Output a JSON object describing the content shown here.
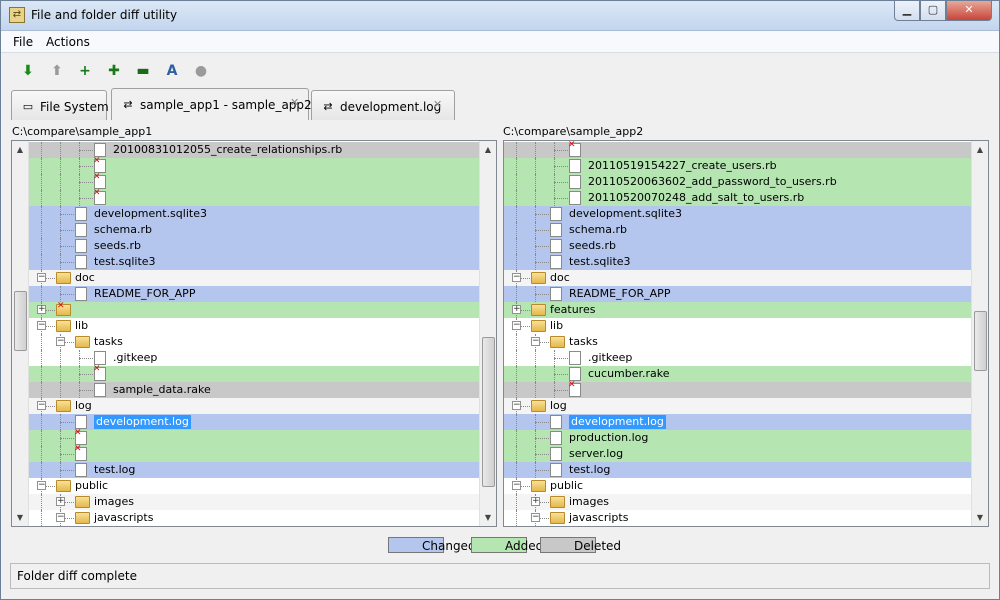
{
  "window": {
    "title": "File and folder diff utility",
    "minimize": "▁",
    "maximize": "▢",
    "close": "✕"
  },
  "menu": [
    "File",
    "Actions"
  ],
  "toolbar": [
    {
      "name": "next-diff-icon",
      "glyph": "⬇",
      "color": "#1a8a1a"
    },
    {
      "name": "prev-diff-icon",
      "glyph": "⬆",
      "color": "#9a9a9a"
    },
    {
      "name": "expand-added-icon",
      "glyph": "+",
      "color": "#1a7a1a"
    },
    {
      "name": "expand-all-icon",
      "glyph": "✚",
      "color": "#1a7a1a"
    },
    {
      "name": "collapse-all-icon",
      "glyph": "▬",
      "color": "#1a6a1a"
    },
    {
      "name": "text-compare-icon",
      "glyph": "A",
      "color": "#3060a0"
    },
    {
      "name": "stop-icon",
      "glyph": "●",
      "color": "#9a9a9a"
    }
  ],
  "tabs": [
    {
      "label": "File System",
      "icon": "computer-icon",
      "close": ""
    },
    {
      "label": "sample_app1 - sample_app2",
      "icon": "compare-icon",
      "close": "✕"
    },
    {
      "label": "development.log",
      "icon": "compare-icon",
      "close": "✕"
    }
  ],
  "paths": {
    "left": "C:\\compare\\sample_app1",
    "right": "C:\\compare\\sample_app2"
  },
  "left_rows": [
    {
      "status": "deleted",
      "depth": 3,
      "kind": "file",
      "label": "20100831012055_create_relationships.rb"
    },
    {
      "status": "added",
      "depth": 3,
      "kind": "missing",
      "label": ""
    },
    {
      "status": "added",
      "depth": 3,
      "kind": "missing",
      "label": ""
    },
    {
      "status": "added",
      "depth": 3,
      "kind": "missing",
      "label": ""
    },
    {
      "status": "changed",
      "depth": 2,
      "kind": "file",
      "label": "development.sqlite3"
    },
    {
      "status": "changed",
      "depth": 2,
      "kind": "file",
      "label": "schema.rb"
    },
    {
      "status": "changed",
      "depth": 2,
      "kind": "file",
      "label": "seeds.rb"
    },
    {
      "status": "changed",
      "depth": 2,
      "kind": "file",
      "label": "test.sqlite3"
    },
    {
      "status": "alt",
      "depth": 1,
      "kind": "folder",
      "expander": "−",
      "label": "doc"
    },
    {
      "status": "changed",
      "depth": 2,
      "kind": "file",
      "label": "README_FOR_APP"
    },
    {
      "status": "added",
      "depth": 1,
      "kind": "missing-folder",
      "expander": "+",
      "label": ""
    },
    {
      "status": "plain",
      "depth": 1,
      "kind": "folder",
      "expander": "−",
      "label": "lib"
    },
    {
      "status": "plain",
      "depth": 2,
      "kind": "folder",
      "expander": "−",
      "label": "tasks"
    },
    {
      "status": "plain",
      "depth": 3,
      "kind": "file",
      "label": ".gitkeep"
    },
    {
      "status": "added",
      "depth": 3,
      "kind": "missing",
      "label": ""
    },
    {
      "status": "deleted",
      "depth": 3,
      "kind": "file",
      "label": "sample_data.rake"
    },
    {
      "status": "alt",
      "depth": 1,
      "kind": "folder",
      "expander": "−",
      "label": "log"
    },
    {
      "status": "changed",
      "depth": 2,
      "kind": "file",
      "label": "development.log",
      "selected": true
    },
    {
      "status": "added",
      "depth": 2,
      "kind": "missing",
      "label": ""
    },
    {
      "status": "added",
      "depth": 2,
      "kind": "missing",
      "label": ""
    },
    {
      "status": "changed",
      "depth": 2,
      "kind": "file",
      "label": "test.log"
    },
    {
      "status": "plain",
      "depth": 1,
      "kind": "folder",
      "expander": "−",
      "label": "public"
    },
    {
      "status": "alt",
      "depth": 2,
      "kind": "folder",
      "expander": "+",
      "label": "images"
    },
    {
      "status": "plain",
      "depth": 2,
      "kind": "folder",
      "expander": "−",
      "label": "javascripts"
    }
  ],
  "right_rows": [
    {
      "status": "deleted",
      "depth": 3,
      "kind": "missing",
      "label": ""
    },
    {
      "status": "added",
      "depth": 3,
      "kind": "file",
      "label": "20110519154227_create_users.rb"
    },
    {
      "status": "added",
      "depth": 3,
      "kind": "file",
      "label": "20110520063602_add_password_to_users.rb"
    },
    {
      "status": "added",
      "depth": 3,
      "kind": "file",
      "label": "20110520070248_add_salt_to_users.rb"
    },
    {
      "status": "changed",
      "depth": 2,
      "kind": "file",
      "label": "development.sqlite3"
    },
    {
      "status": "changed",
      "depth": 2,
      "kind": "file",
      "label": "schema.rb"
    },
    {
      "status": "changed",
      "depth": 2,
      "kind": "file",
      "label": "seeds.rb"
    },
    {
      "status": "changed",
      "depth": 2,
      "kind": "file",
      "label": "test.sqlite3"
    },
    {
      "status": "alt",
      "depth": 1,
      "kind": "folder",
      "expander": "−",
      "label": "doc"
    },
    {
      "status": "changed",
      "depth": 2,
      "kind": "file",
      "label": "README_FOR_APP"
    },
    {
      "status": "added",
      "depth": 1,
      "kind": "folder",
      "expander": "+",
      "label": "features"
    },
    {
      "status": "plain",
      "depth": 1,
      "kind": "folder",
      "expander": "−",
      "label": "lib"
    },
    {
      "status": "plain",
      "depth": 2,
      "kind": "folder",
      "expander": "−",
      "label": "tasks"
    },
    {
      "status": "plain",
      "depth": 3,
      "kind": "file",
      "label": ".gitkeep"
    },
    {
      "status": "added",
      "depth": 3,
      "kind": "file",
      "label": "cucumber.rake"
    },
    {
      "status": "deleted",
      "depth": 3,
      "kind": "missing",
      "label": ""
    },
    {
      "status": "alt",
      "depth": 1,
      "kind": "folder",
      "expander": "−",
      "label": "log"
    },
    {
      "status": "changed",
      "depth": 2,
      "kind": "file",
      "label": "development.log",
      "selected": true
    },
    {
      "status": "added",
      "depth": 2,
      "kind": "file",
      "label": "production.log"
    },
    {
      "status": "added",
      "depth": 2,
      "kind": "file",
      "label": "server.log"
    },
    {
      "status": "changed",
      "depth": 2,
      "kind": "file",
      "label": "test.log"
    },
    {
      "status": "plain",
      "depth": 1,
      "kind": "folder",
      "expander": "−",
      "label": "public"
    },
    {
      "status": "alt",
      "depth": 2,
      "kind": "folder",
      "expander": "+",
      "label": "images"
    },
    {
      "status": "plain",
      "depth": 2,
      "kind": "folder",
      "expander": "−",
      "label": "javascripts"
    }
  ],
  "legend": [
    {
      "label": "Changed",
      "color": "#b4c6ee"
    },
    {
      "label": "Added",
      "color": "#b5e6b2"
    },
    {
      "label": "Deleted",
      "color": "#c8c8c8"
    }
  ],
  "status": "Folder diff complete"
}
